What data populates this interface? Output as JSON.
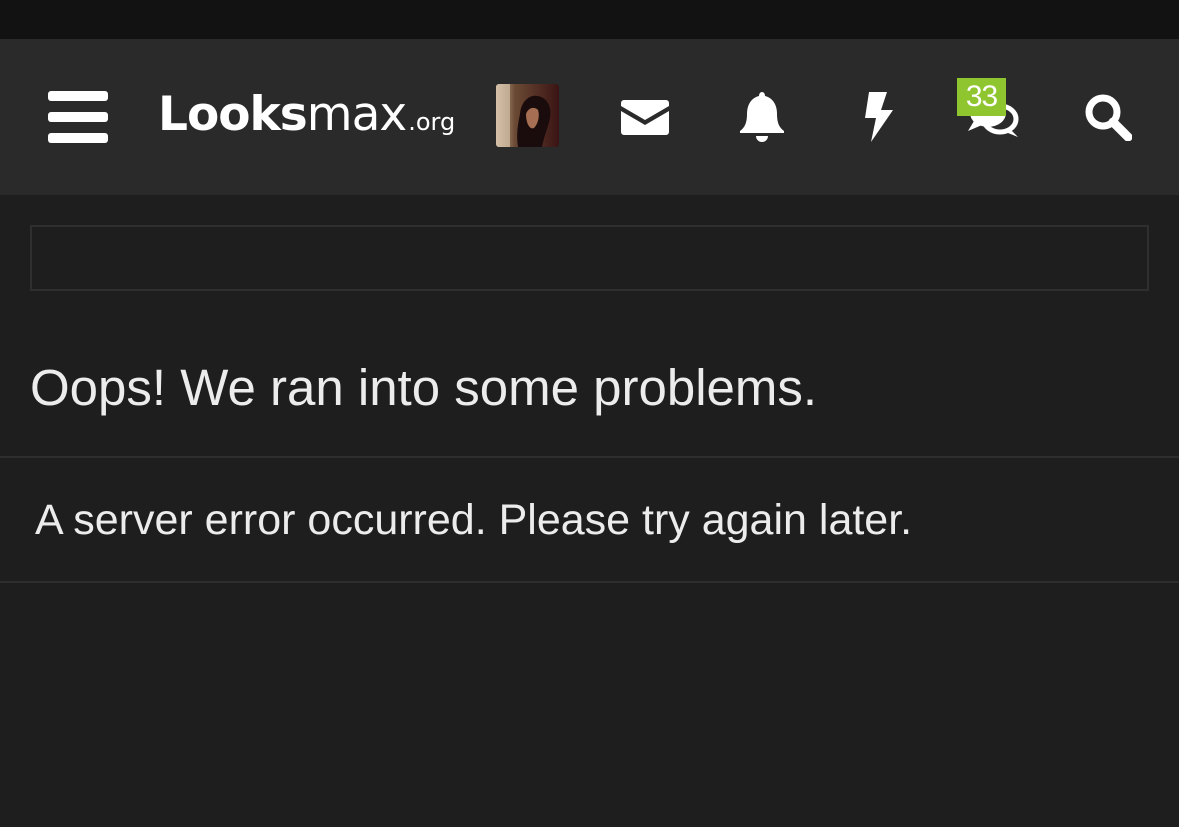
{
  "header": {
    "logo": {
      "main_bold": "L",
      "main_o": "oo",
      "main_rest_bold": "ks",
      "main_rest_light": "max",
      "tld": ".org"
    },
    "avatar": {
      "alt": "user avatar"
    },
    "icons": {
      "menu": "hamburger-menu-icon",
      "inbox": "envelope-icon",
      "alerts": "bell-icon",
      "whats_new": "bolt-icon",
      "conversations": "chat-bubbles-icon",
      "search": "search-icon"
    },
    "chat_badge": "33"
  },
  "content": {
    "title": "Oops! We ran into some problems.",
    "message": "A server error occurred. Please try again later."
  },
  "colors": {
    "background": "#1e1e1e",
    "navbar": "#2a2a2a",
    "status_strip": "#121212",
    "badge": "#8fc62f",
    "text": "#ececec"
  }
}
